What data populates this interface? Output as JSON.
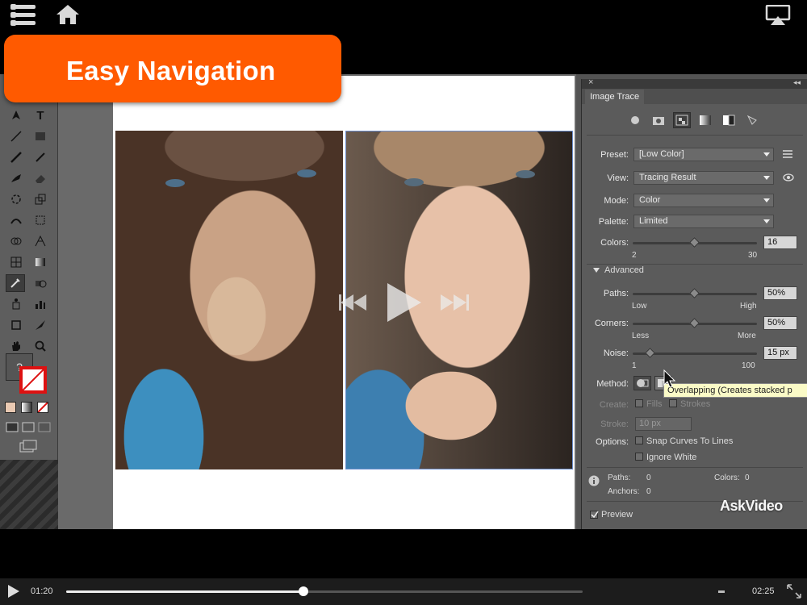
{
  "toast": {
    "text": "Easy Navigation"
  },
  "tools_panel": {
    "type_tool_glyph": "T",
    "color_unknown_glyph": "?"
  },
  "image_trace": {
    "tab_label": "Image Trace",
    "preset": {
      "label": "Preset:",
      "value": "[Low Color]"
    },
    "view": {
      "label": "View:",
      "value": "Tracing Result"
    },
    "mode": {
      "label": "Mode:",
      "value": "Color"
    },
    "palette": {
      "label": "Palette:",
      "value": "Limited"
    },
    "colors": {
      "label": "Colors:",
      "value": "16",
      "min": "2",
      "max": "30",
      "level": 16
    },
    "advanced_label": "Advanced",
    "paths": {
      "label": "Paths:",
      "value": "50%",
      "min": "Low",
      "max": "High",
      "level": 50
    },
    "corners": {
      "label": "Corners:",
      "value": "50%",
      "min": "Less",
      "max": "More",
      "level": 50
    },
    "noise": {
      "label": "Noise:",
      "value": "15 px",
      "min": "1",
      "max": "100",
      "level": 15
    },
    "method_label": "Method:",
    "create": {
      "label": "Create:",
      "fills": "Fills",
      "strokes": "Strokes"
    },
    "stroke": {
      "label": "Stroke:",
      "value": "10 px"
    },
    "options": {
      "label": "Options:",
      "snap": "Snap Curves To Lines",
      "ignore_white": "Ignore White"
    },
    "info": {
      "paths_label": "Paths:",
      "paths_value": "0",
      "colors_label": "Colors:",
      "colors_value": "0",
      "anchors_label": "Anchors:",
      "anchors_value": "0"
    },
    "preview_label": "Preview"
  },
  "tooltip": "Overlapping (Creates stacked p",
  "watermark": "AskVideo",
  "player": {
    "current_time": "01:20",
    "total_time": "02:25",
    "progress": 0.46
  },
  "colors": {
    "toast": "#ff5a00",
    "selection": "#6b8ecf"
  },
  "icons": [
    "menu-icon",
    "home-icon",
    "airplay-icon",
    "play-icon",
    "rewind-icon",
    "fast-forward-icon",
    "fullscreen-icon"
  ]
}
